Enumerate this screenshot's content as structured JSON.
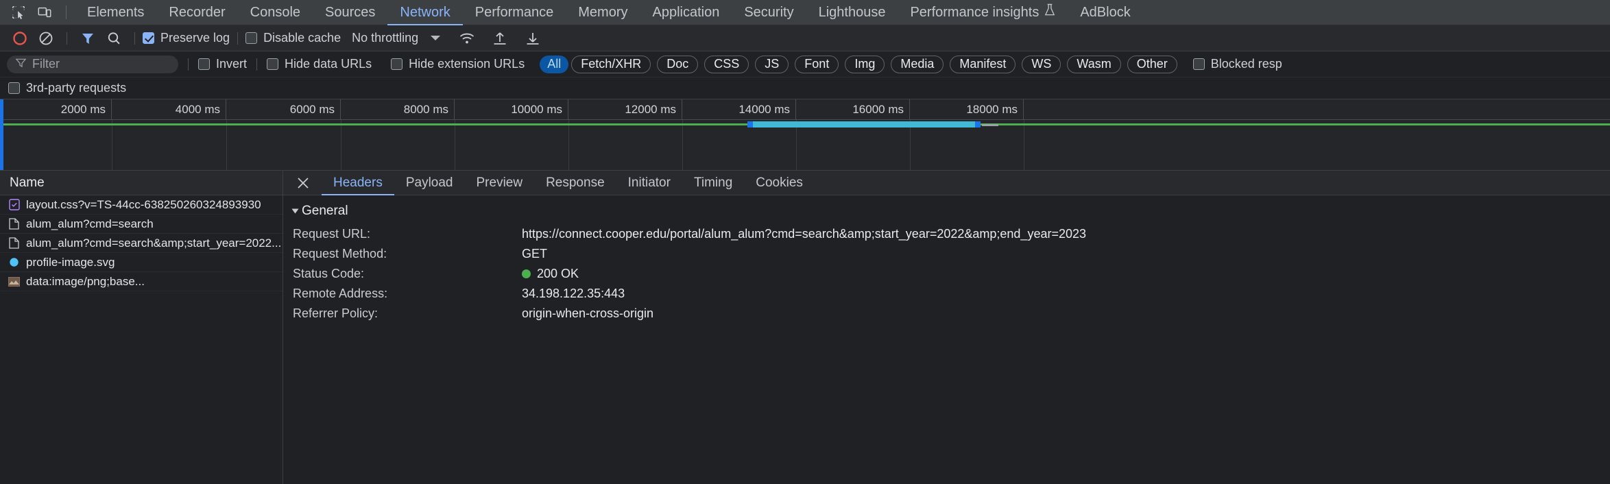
{
  "tabbar": {
    "inspect_icon": "inspect-element-icon",
    "device_icon": "device-toolbar-icon",
    "tabs": [
      {
        "label": "Elements",
        "active": false
      },
      {
        "label": "Recorder",
        "active": false
      },
      {
        "label": "Console",
        "active": false
      },
      {
        "label": "Sources",
        "active": false
      },
      {
        "label": "Network",
        "active": true
      },
      {
        "label": "Performance",
        "active": false
      },
      {
        "label": "Memory",
        "active": false
      },
      {
        "label": "Application",
        "active": false
      },
      {
        "label": "Security",
        "active": false
      },
      {
        "label": "Lighthouse",
        "active": false
      },
      {
        "label": "Performance insights",
        "active": false,
        "beaker": "⚗"
      },
      {
        "label": "AdBlock",
        "active": false
      }
    ]
  },
  "toolbar": {
    "record_icon": "record-button-icon",
    "clear_icon": "clear-network-log-icon",
    "filter_icon": "filter-funnel-icon",
    "search_icon": "search-icon",
    "preserve_log": {
      "label": "Preserve log",
      "checked": true
    },
    "disable_cache": {
      "label": "Disable cache",
      "checked": false
    },
    "throttling": "No throttling",
    "wifi_icon": "network-conditions-wifi-icon",
    "import_icon": "import-har-icon",
    "export_icon": "export-har-icon"
  },
  "filterbar": {
    "filter_placeholder": "Filter",
    "filter_value": "",
    "invert": {
      "label": "Invert",
      "checked": false
    },
    "hide_data_urls": {
      "label": "Hide data URLs",
      "checked": false
    },
    "hide_extension_urls": {
      "label": "Hide extension URLs",
      "checked": false
    },
    "types": [
      {
        "label": "All",
        "selected": true,
        "plain": true
      },
      {
        "label": "Fetch/XHR",
        "selected": false
      },
      {
        "label": "Doc",
        "selected": false
      },
      {
        "label": "CSS",
        "selected": false
      },
      {
        "label": "JS",
        "selected": false
      },
      {
        "label": "Font",
        "selected": false
      },
      {
        "label": "Img",
        "selected": false
      },
      {
        "label": "Media",
        "selected": false
      },
      {
        "label": "Manifest",
        "selected": false
      },
      {
        "label": "WS",
        "selected": false
      },
      {
        "label": "Wasm",
        "selected": false
      },
      {
        "label": "Other",
        "selected": false
      }
    ],
    "blocked_responses": {
      "label": "Blocked resp",
      "checked": false
    },
    "third_party": {
      "label": "3rd-party requests",
      "checked": false
    }
  },
  "overview": {
    "ticks": [
      "2000 ms",
      "4000 ms",
      "6000 ms",
      "8000 ms",
      "10000 ms",
      "12000 ms",
      "14000 ms",
      "16000 ms",
      "18000 ms"
    ],
    "load_line_color": "#4caf50",
    "marker_color": "#1a73e8",
    "bar_colors": {
      "wait": "#4caf50",
      "receive": "#41b8d5",
      "end": "#1a73e8",
      "gray": "#9aa0a6"
    }
  },
  "requests": {
    "column_name": "Name",
    "rows": [
      {
        "name": "layout.css?v=TS-44cc-638250260324893930",
        "icon": "stylesheet-icon",
        "icon_color": "#b388ff"
      },
      {
        "name": "alum_alum?cmd=search",
        "icon": "document-icon",
        "icon_color": "#c9cdd1"
      },
      {
        "name": "alum_alum?cmd=search&amp;start_year=2022...",
        "icon": "document-icon",
        "icon_color": "#c9cdd1"
      },
      {
        "name": "profile-image.svg",
        "icon": "image-circle-icon",
        "icon_color": "#4fc3f7"
      },
      {
        "name": "data:image/png;base...",
        "icon": "image-thumbnail-icon",
        "icon_color": "#8d6e63"
      }
    ]
  },
  "details": {
    "close_icon": "close-icon",
    "tabs": [
      {
        "label": "Headers",
        "active": true
      },
      {
        "label": "Payload",
        "active": false
      },
      {
        "label": "Preview",
        "active": false
      },
      {
        "label": "Response",
        "active": false
      },
      {
        "label": "Initiator",
        "active": false
      },
      {
        "label": "Timing",
        "active": false
      },
      {
        "label": "Cookies",
        "active": false
      }
    ],
    "general": {
      "title": "General",
      "fields": [
        {
          "key": "Request URL:",
          "value": "https://connect.cooper.edu/portal/alum_alum?cmd=search&amp;start_year=2022&amp;end_year=2023",
          "status_dot": false
        },
        {
          "key": "Request Method:",
          "value": "GET",
          "status_dot": false
        },
        {
          "key": "Status Code:",
          "value": "200 OK",
          "status_dot": true
        },
        {
          "key": "Remote Address:",
          "value": "34.198.122.35:443",
          "status_dot": false
        },
        {
          "key": "Referrer Policy:",
          "value": "origin-when-cross-origin",
          "status_dot": false
        }
      ]
    }
  }
}
